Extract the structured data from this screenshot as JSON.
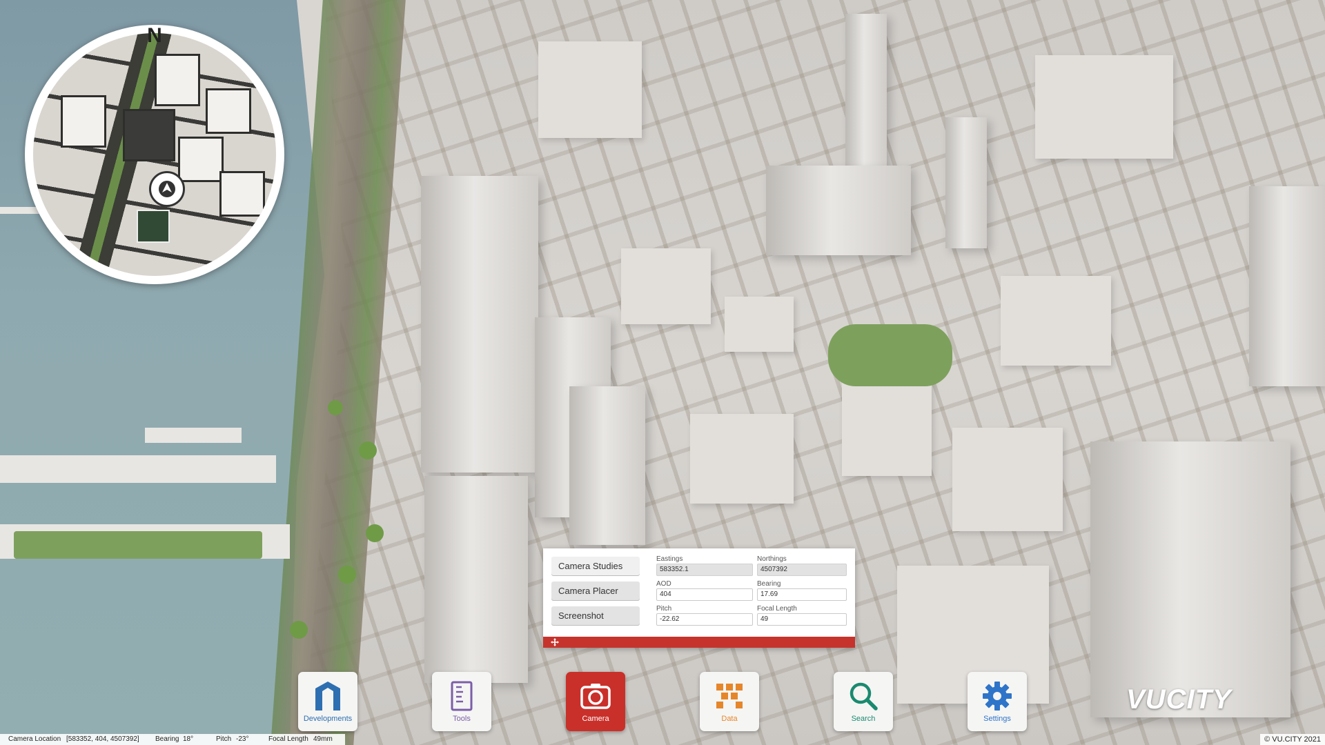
{
  "camera_panel": {
    "tabs": [
      "Camera Studies",
      "Camera Placer",
      "Screenshot"
    ],
    "fields": {
      "eastings": {
        "label": "Eastings",
        "value": "583352.1"
      },
      "northings": {
        "label": "Northings",
        "value": "4507392"
      },
      "aod": {
        "label": "AOD",
        "value": "404"
      },
      "bearing": {
        "label": "Bearing",
        "value": "17.69"
      },
      "pitch": {
        "label": "Pitch",
        "value": "-22.62"
      },
      "focal_length": {
        "label": "Focal Length",
        "value": "49"
      }
    },
    "accent_color": "#c6332c"
  },
  "minimap": {
    "north_label": "N"
  },
  "dock": {
    "developments": "Developments",
    "tools": "Tools",
    "camera": "Camera",
    "data": "Data",
    "search": "Search",
    "settings": "Settings"
  },
  "logo": "VUCITY",
  "status_bar": {
    "camera_location_label": "Camera Location",
    "camera_location_value": "[583352, 404, 4507392]",
    "bearing_label": "Bearing",
    "bearing_value": "18°",
    "pitch_label": "Pitch",
    "pitch_value": "-23°",
    "focal_label": "Focal Length",
    "focal_value": "49mm"
  },
  "copyright": "© VU.CITY 2021",
  "colors": {
    "developments": "#2e6fb1",
    "tools": "#7b5ea7",
    "camera": "#c9302a",
    "data": "#e6862a",
    "search": "#1a8a6f",
    "settings": "#2e74c9"
  }
}
